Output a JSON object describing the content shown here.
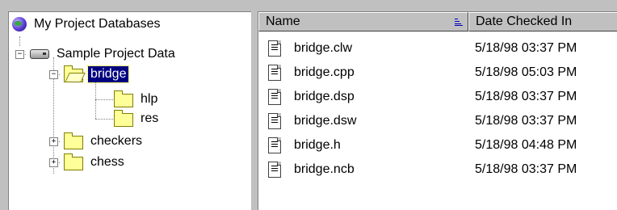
{
  "tree": {
    "root": {
      "label": "My Project Databases",
      "icon": "globe-icon"
    },
    "database": {
      "label": "Sample Project Data",
      "icon": "database-drive-icon"
    },
    "nodes": [
      {
        "label": "bridge",
        "icon": "open-folder-icon",
        "selected": true
      },
      {
        "label": "hlp",
        "icon": "folder-icon"
      },
      {
        "label": "res",
        "icon": "folder-icon"
      },
      {
        "label": "checkers",
        "icon": "folder-icon"
      },
      {
        "label": "chess",
        "icon": "folder-icon"
      }
    ],
    "expand_symbol": "+",
    "collapse_symbol": "−"
  },
  "list": {
    "columns": [
      {
        "label": "Name",
        "sorted": "ascending"
      },
      {
        "label": "Date Checked In"
      }
    ],
    "files": [
      {
        "name": "bridge.clw",
        "date": "5/18/98 03:37 PM"
      },
      {
        "name": "bridge.cpp",
        "date": "5/18/98 05:03 PM"
      },
      {
        "name": "bridge.dsp",
        "date": "5/18/98 03:37 PM"
      },
      {
        "name": "bridge.dsw",
        "date": "5/18/98 03:37 PM"
      },
      {
        "name": "bridge.h",
        "date": "5/18/98 04:48 PM"
      },
      {
        "name": "bridge.ncb",
        "date": "5/18/98 03:37 PM"
      }
    ]
  },
  "colors": {
    "window_bg": "#c0c0c0",
    "selection_bg": "#000080",
    "selection_text": "#ffffff",
    "folder_yellow": "#ffff99"
  }
}
